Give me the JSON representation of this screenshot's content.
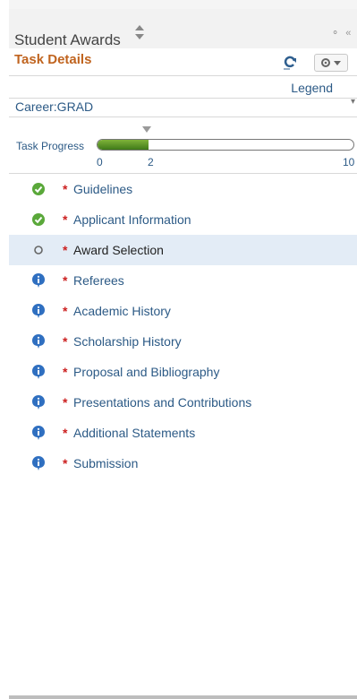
{
  "panel": {
    "title": "Student Awards"
  },
  "section": {
    "title": "Task Details",
    "legend_label": "Legend"
  },
  "career": {
    "text": "Career:GRAD"
  },
  "progress": {
    "label": "Task Progress",
    "completed": 2,
    "total": 10,
    "ticks": [
      "0",
      "2",
      "10"
    ]
  },
  "tasks": [
    {
      "label": "Guidelines",
      "status": "complete",
      "icon": "green-check-icon"
    },
    {
      "label": "Applicant Information",
      "status": "complete",
      "icon": "green-check-icon"
    },
    {
      "label": "Award Selection",
      "status": "current",
      "icon": "open-circle-icon"
    },
    {
      "label": "Referees",
      "status": "info",
      "icon": "blue-info-icon"
    },
    {
      "label": "Academic History",
      "status": "info",
      "icon": "blue-info-icon"
    },
    {
      "label": "Scholarship History",
      "status": "info",
      "icon": "blue-info-icon"
    },
    {
      "label": "Proposal and Bibliography",
      "status": "info",
      "icon": "blue-info-icon"
    },
    {
      "label": "Presentations and Contributions",
      "status": "info",
      "icon": "blue-info-icon"
    },
    {
      "label": "Additional Statements",
      "status": "info",
      "icon": "blue-info-icon"
    },
    {
      "label": "Submission",
      "status": "info",
      "icon": "blue-info-icon"
    }
  ],
  "required_marker": "*",
  "colors": {
    "accent": "#c0641f",
    "link": "#2c5a86",
    "required": "#cc1f1f",
    "progress": "#5a9428",
    "selected_row": "#e3ecf6"
  }
}
